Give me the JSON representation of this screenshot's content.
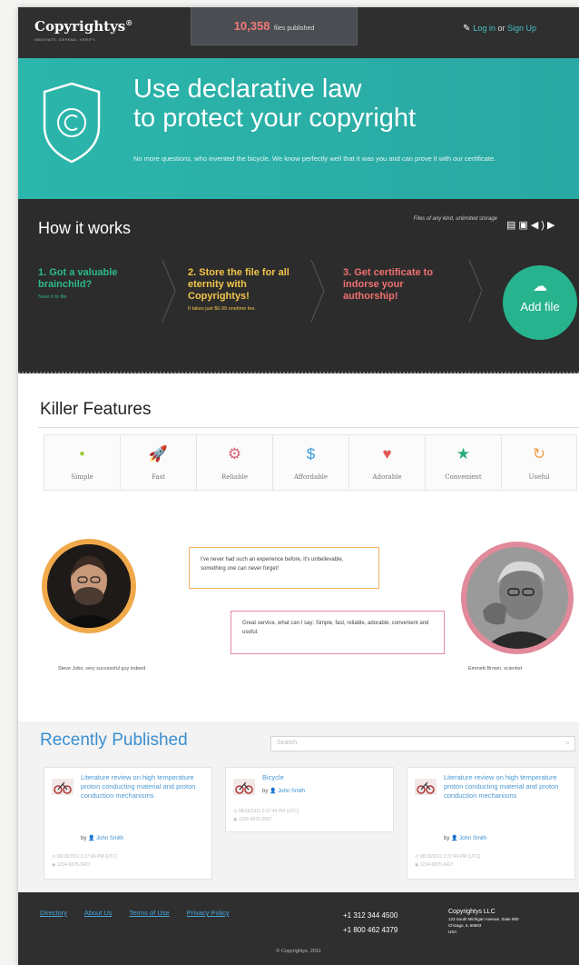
{
  "header": {
    "logo": "Copyrightys",
    "logo_mark": "®",
    "logo_tagline": "INNOVATE. DEFEND. VERIFY.",
    "files_count": "10,358",
    "files_label": "files published",
    "login": "Log in",
    "or": "or",
    "signup": "Sign Up"
  },
  "hero": {
    "title_line1": "Use declarative law",
    "title_line2": "to protect your copyright",
    "subtitle": "No more questions, who invented the bicycle. We know perfectly well that it was you and can prove it with our certificate."
  },
  "how": {
    "title": "How it works",
    "storage_note": "Files of any kind, unlimited storage",
    "steps": [
      {
        "title": "1. Got a valuable brainchild?",
        "sub": "Save it to file"
      },
      {
        "title": "2. Store the file for all eternity with Copyrightys!",
        "sub": "It takes just $0.99 onetime fee."
      },
      {
        "title": "3. Get certificate to indorse your authorship!",
        "sub": ""
      }
    ],
    "add_file": "Add file"
  },
  "features": {
    "title": "Killer Features",
    "items": [
      {
        "label": "Simple",
        "icon": "dot-icon",
        "color": "#9ccc3c"
      },
      {
        "label": "Fast",
        "icon": "rocket-icon",
        "color": "#2aa8a3"
      },
      {
        "label": "Reliable",
        "icon": "gear-icon",
        "color": "#d8667a"
      },
      {
        "label": "Affordable",
        "icon": "dollar-icon",
        "color": "#3a9ad8"
      },
      {
        "label": "Adorable",
        "icon": "heart-icon",
        "color": "#e05858"
      },
      {
        "label": "Convenient",
        "icon": "star-icon",
        "color": "#2cab7a"
      },
      {
        "label": "Useful",
        "icon": "refresh-icon",
        "color": "#f0a050"
      }
    ]
  },
  "testimonials": [
    {
      "quote": "I've never had such an experience before, it's unbelievable, something one can never forget!",
      "caption": "Steve Jobs, very successful guy indeed"
    },
    {
      "quote": "Great service, what can I say: Simple, fast, reliable, adorable, convenient and useful.",
      "caption": "Emmett Brown, scientist"
    }
  ],
  "recent": {
    "title": "Recently Published",
    "search_placeholder": "Search",
    "cards": [
      {
        "title": "Literature review on high temperature proton conducting material and proton conduction mechanisms",
        "author": "John Smith",
        "date": "08/18/2011 2:37:49 PM (UTC)",
        "hash": "1234-9875-3427"
      },
      {
        "title": "Bicycle",
        "author": "John Smith",
        "date": "08/18/2011 2:37:49 PM (UTC)",
        "hash": "1234-9875-3427"
      },
      {
        "title": "Literature review on high temperature proton conducting material and proton conduction mechanisms",
        "author": "John Smith",
        "date": "08/18/2011 2:37:49 PM (UTC)",
        "hash": "1234-9875-3427"
      }
    ]
  },
  "footer": {
    "links": [
      "Directory",
      "About Us",
      "Terms of Use",
      "Privacy Policy"
    ],
    "phone1": "+1 312 344 4500",
    "phone2": "+1 800 462 4379",
    "company": "Copyrightys LLC",
    "address1": "123 South Michigan Avenue, Suite 900",
    "address2": "Chicago, IL 60603",
    "address3": "USA",
    "copyright": "© Copyrightys, 2011"
  },
  "colors": {
    "teal": "#2bb6ab",
    "dark": "#2c2c2c",
    "step1": "#2db98a",
    "step2": "#f3c54a",
    "step3": "#f07070",
    "link_blue": "#3a8fd0",
    "jobs_ring": "#f0a94a",
    "brown_ring": "#e08a9a"
  }
}
